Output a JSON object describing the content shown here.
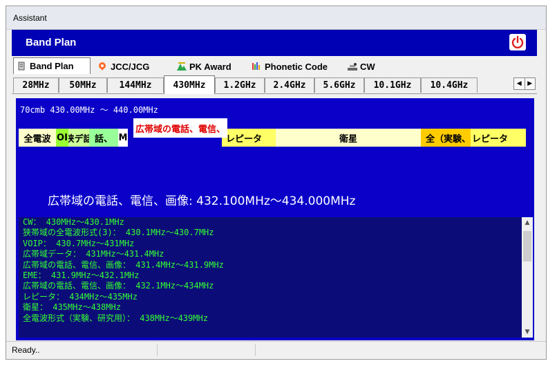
{
  "window": {
    "title": "Assistant"
  },
  "header": {
    "title": "Band Plan",
    "power_icon": "power-icon"
  },
  "main_tabs": [
    {
      "label": "Band Plan",
      "icon": "document-icon",
      "active": true
    },
    {
      "label": "JCC/JCG",
      "icon": "location-pin-icon",
      "active": false
    },
    {
      "label": "PK Award",
      "icon": "award-icon",
      "active": false
    },
    {
      "label": "Phonetic Code",
      "icon": "phonetic-icon",
      "active": false
    },
    {
      "label": "CW",
      "icon": "cw-key-icon",
      "active": false
    }
  ],
  "band_tabs": [
    {
      "label": "28MHz",
      "active": false
    },
    {
      "label": "50MHz",
      "active": false
    },
    {
      "label": "144MHz",
      "active": false
    },
    {
      "label": "430MHz",
      "active": true
    },
    {
      "label": "1.2GHz",
      "active": false
    },
    {
      "label": "2.4GHz",
      "active": false
    },
    {
      "label": "5.6GHz",
      "active": false
    },
    {
      "label": "10.1GHz",
      "active": false
    },
    {
      "label": "10.4GHz",
      "active": false
    }
  ],
  "plan": {
    "range_label": "70cmb 430.00MHz ～ 440.00MHz",
    "segments": [
      {
        "label": "全電波",
        "color": "#ffffcc"
      },
      {
        "label": "OI",
        "color": "#99ff33"
      },
      {
        "label": "狭デ話",
        "color": "#ccff99"
      },
      {
        "label": "話、",
        "color": "#99ff99"
      },
      {
        "label": "M",
        "color": "#ffffff"
      },
      {
        "label": "レピータ",
        "color": "#ffff66"
      },
      {
        "label": "衛星",
        "color": "#ffffcc"
      },
      {
        "label": "全（実験、",
        "color": "#ffcc00"
      },
      {
        "label": "レピータ",
        "color": "#ffff66"
      }
    ],
    "popup_text": "広帯域の電話、電信、",
    "selected_label": "広帯域の電話、電信、画像: 432.100MHz～434.000MHz",
    "details": [
      "CW： 430MHz～430.1MHz",
      "狭帯域の全電波形式(3)： 430.1MHz～430.7MHz",
      "VOIP： 430.7MHz～431MHz",
      "広帯域データ： 431MHz～431.4MHz",
      "広帯域の電話、電信、画像： 431.4MHz～431.9MHz",
      "EME： 431.9MHz～432.1MHz",
      "広帯域の電話、電信、画像： 432.1MHz～434MHz",
      "レピータ： 434MHz～435MHz",
      "衛星： 435MHz～438MHz",
      "全電波形式（実験、研究用）： 438MHz～439MHz"
    ]
  },
  "status": {
    "text": "Ready.."
  },
  "colors": {
    "header": "#0000b4",
    "panel": "#0a00c8",
    "list_bg": "#0c0c78",
    "list_text": "#33ff33"
  }
}
